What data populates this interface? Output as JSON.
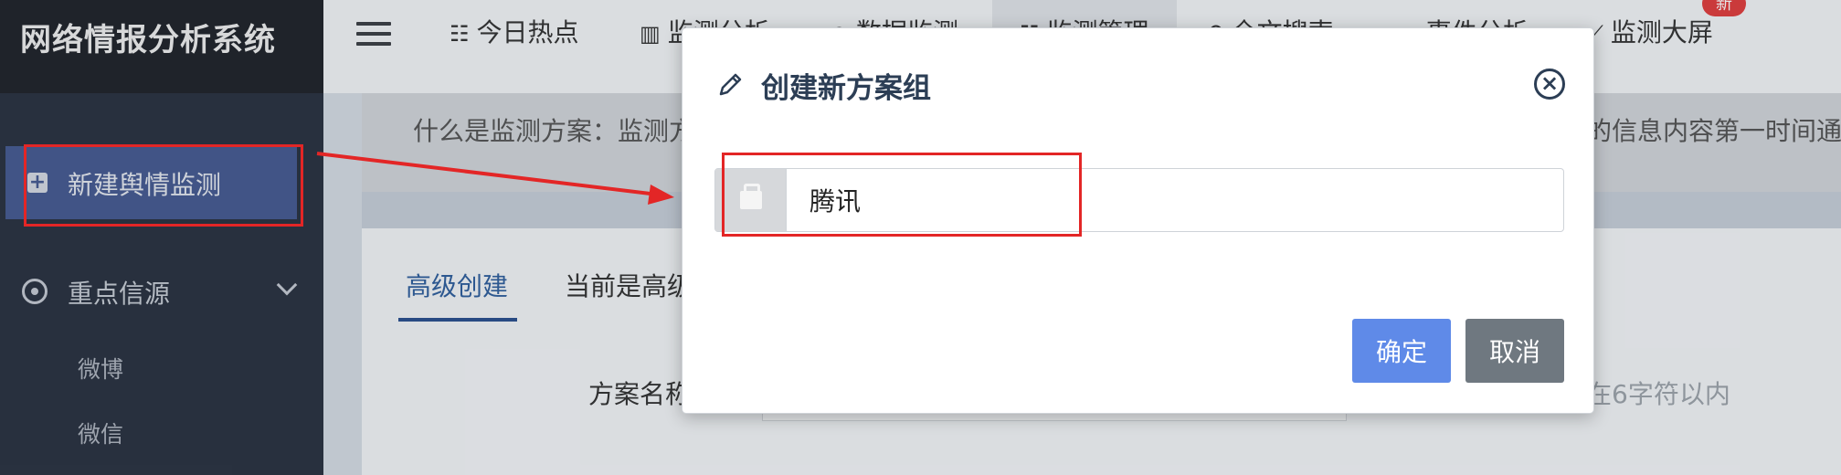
{
  "sidebar": {
    "brand": "网络情报分析系统",
    "new_monitor_label": "新建舆情监测",
    "group_label": "重点信源",
    "sub_items": [
      "微博",
      "微信"
    ]
  },
  "topbar": {
    "menu_icon": "hamburger-icon",
    "items": [
      {
        "icon": "list-icon",
        "label": "今日热点"
      },
      {
        "icon": "bar-chart-icon",
        "label": "监测分析"
      },
      {
        "icon": "globe-icon",
        "label": "数据监测"
      },
      {
        "icon": "list-icon",
        "label": "监测管理"
      },
      {
        "icon": "search-icon",
        "label": "全文搜索"
      },
      {
        "icon": "window-icon",
        "label": "事件分析"
      },
      {
        "icon": "line-chart-icon",
        "label": "监测大屏"
      }
    ],
    "badge": "新"
  },
  "content": {
    "info_left": "什么是监测方案：监测方",
    "info_right": "的信息内容第一时间通",
    "tab_active": "高级创建",
    "tab_other": "当前是高级",
    "form_label": "方案名称",
    "form_hint": "在6字符以内"
  },
  "modal": {
    "title": "创建新方案组",
    "input_value": "腾讯",
    "confirm_label": "确定",
    "cancel_label": "取消"
  },
  "colors": {
    "sidebar_bg": "#2a3240",
    "active_nav": "#465b92",
    "confirm_button": "#5f8ae8",
    "cancel_button": "#6f7880",
    "annotation": "#e32626"
  }
}
